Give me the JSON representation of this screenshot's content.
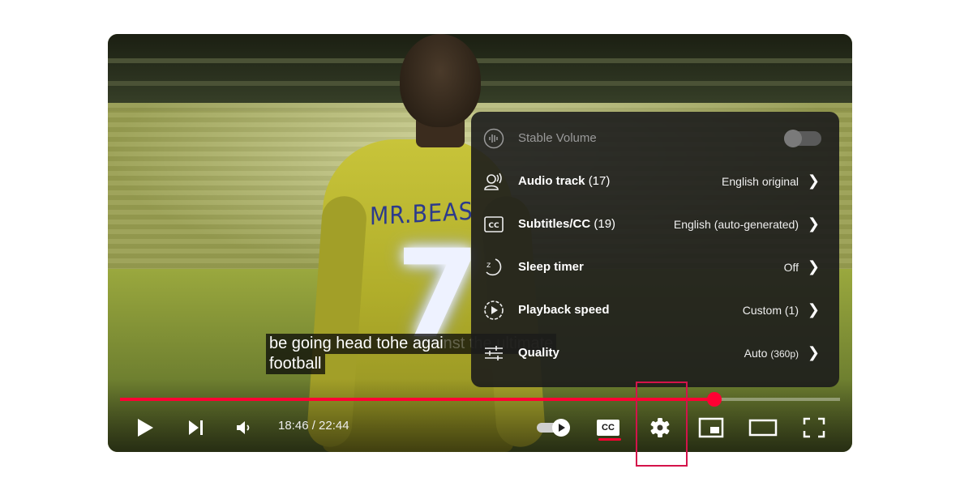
{
  "captions": {
    "line1_visible": "be going head tohe agai",
    "line1_behind": "nst the ultimate",
    "line2": "football"
  },
  "jersey": {
    "name": "MR.BEAS",
    "number": "7"
  },
  "settings_menu": {
    "items": [
      {
        "label": "Stable Volume",
        "icon": "stable-volume-icon",
        "control": "toggle",
        "toggle_on": false,
        "disabled": true
      },
      {
        "label": "Audio track",
        "count": "(17)",
        "value": "English original",
        "icon": "audio-track-icon"
      },
      {
        "label": "Subtitles/CC",
        "count": "(19)",
        "value": "English (auto-generated)",
        "icon": "subtitles-icon"
      },
      {
        "label": "Sleep timer",
        "value": "Off",
        "icon": "sleep-timer-icon"
      },
      {
        "label": "Playback speed",
        "value": "Custom (1)",
        "icon": "playback-speed-icon"
      },
      {
        "label": "Quality",
        "value": "Auto",
        "value_small": "(360p)",
        "icon": "quality-icon"
      }
    ]
  },
  "controls": {
    "time": "18:46 / 22:44",
    "progress_fraction": 0.826,
    "icons": [
      "play-icon",
      "next-icon",
      "volume-icon",
      "autoplay-toggle-icon",
      "cc-icon",
      "settings-gear-icon",
      "miniplayer-icon",
      "theater-mode-icon",
      "fullscreen-icon"
    ],
    "cc_label": "CC",
    "accent_color": "#ff0033",
    "highlight_color": "#d4134a"
  }
}
